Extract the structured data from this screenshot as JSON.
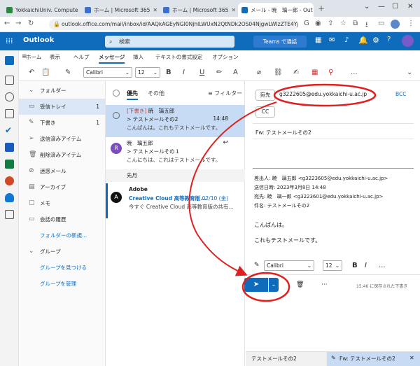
{
  "browser": {
    "tabs": [
      {
        "label": "YokkaichiUniv. Compute",
        "active": false
      },
      {
        "label": "ホーム | Microsoft 365",
        "active": false
      },
      {
        "label": "ホーム | Microsoft 365",
        "active": false
      },
      {
        "label": "メール - 暁　璃一郎 - Out",
        "active": true
      }
    ],
    "url": "outlook.office.com/mail/inbox/id/AAQkAGEyNGI0NjhlLWUxN2QtNDk2OS04NjgwLWIzZTE4YjdiZGJhY..."
  },
  "outlook": {
    "brand": "Outlook",
    "search_placeholder": "検索",
    "teams_label": "Teams で通話"
  },
  "menu": {
    "tabs": [
      "ホーム",
      "表示",
      "ヘルプ",
      "メッセージ",
      "挿入",
      "テキストの書式設定",
      "オプション"
    ],
    "active_tab": "メッセージ"
  },
  "ribbon": {
    "font": "Calibri",
    "size": "12",
    "bold": "B",
    "italic": "I",
    "underline": "U",
    "more": "..."
  },
  "folders": {
    "header": "フォルダー",
    "items": [
      {
        "label": "受信トレイ",
        "count": "1",
        "selected": true
      },
      {
        "label": "下書き",
        "count": "1",
        "selected": false
      },
      {
        "label": "送信済みアイテム",
        "count": "",
        "selected": false
      },
      {
        "label": "削除済みアイテム",
        "count": "",
        "selected": false
      },
      {
        "label": "迷惑メール",
        "count": "",
        "selected": false
      },
      {
        "label": "アーカイブ",
        "count": "",
        "selected": false
      },
      {
        "label": "メモ",
        "count": "",
        "selected": false
      },
      {
        "label": "会話の履歴",
        "count": "",
        "selected": false
      }
    ],
    "new_folder": "フォルダーの新規...",
    "groups_header": "グループ",
    "find_groups": "グループを見つける",
    "manage_groups": "グループを管理"
  },
  "message_list": {
    "focused_tab": "優先",
    "other_tab": "その他",
    "filter_label": "フィルター",
    "section_last_month": "先月",
    "messages": [
      {
        "draft_tag": "[下書き]",
        "sender": "暁　璃五郎",
        "subject": "> テストメールその2",
        "time": "14:48",
        "preview": "こんばんは。これもテストメールです。"
      },
      {
        "avatar": "R",
        "sender": "暁　璃五郎",
        "subject": "> テストメールその１",
        "time": "",
        "preview": "こんにちは、これはテストメールです。"
      },
      {
        "avatar": "A",
        "sender": "Adobe",
        "subject": "Creative Cloud 高等教育版...",
        "time": "02/10 (金)",
        "preview": "今すぐ Creative Cloud 高等教育版の共有..."
      }
    ]
  },
  "compose": {
    "to_label": "宛先",
    "to_value": "g3222605@edu.yokkaichi-u.ac.jp",
    "bcc_label": "BCC",
    "cc_label": "CC",
    "subject": "Fw: テストメールその2",
    "header_from": "差出人: 暁　璃五郎 <g3223605@edu.yokkaichi-u.ac.jp>",
    "header_sent": "送信日時: 2023年3月8日 14:48",
    "header_to": "宛先: 暁　璃一郎 <g3223601@edu.yokkaichi-u.ac.jp>",
    "header_subject": "件名: テストメールその2",
    "body_line1": "こんばんは。",
    "body_line2": "これもテストメールです。",
    "format_font": "Calibri",
    "format_size": "12",
    "saved_status": "15:46 に保存された下書き"
  },
  "bottom_tabs": {
    "tab1": "テストメールその2",
    "tab2": "Fw: テストメールその2"
  },
  "colors": {
    "accent": "#0f6cbd",
    "annotation_red": "#e02020"
  }
}
